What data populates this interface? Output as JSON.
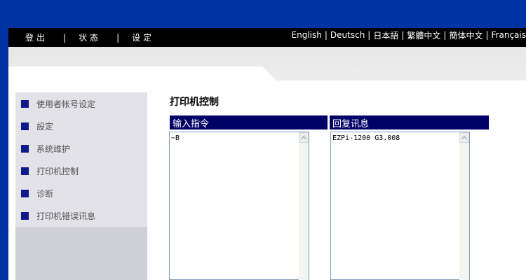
{
  "nav": {
    "logout": "登出",
    "status": "状态",
    "settings": "设定",
    "separator": "|",
    "languages": [
      "English",
      "Deutsch",
      "日本語",
      "繁體中文",
      "簡体中文",
      "Français"
    ],
    "lang_sep": "|"
  },
  "sidebar": {
    "items": [
      {
        "label": "使用者帐号设定"
      },
      {
        "label": "設定"
      },
      {
        "label": "系统维护"
      },
      {
        "label": "打印机控制"
      },
      {
        "label": "诊断"
      },
      {
        "label": "打印机错误讯息"
      }
    ]
  },
  "main": {
    "title": "打印机控制",
    "input_panel": {
      "header": "输入指令",
      "value": "~B"
    },
    "reply_panel": {
      "header": "回复讯息",
      "value": "EZPi-1200 G3.008"
    }
  },
  "colors": {
    "frame_blue": "#0033a3",
    "nav_black": "#000000",
    "panel_header": "#000066",
    "sidebar_bullet": "#10198a"
  }
}
